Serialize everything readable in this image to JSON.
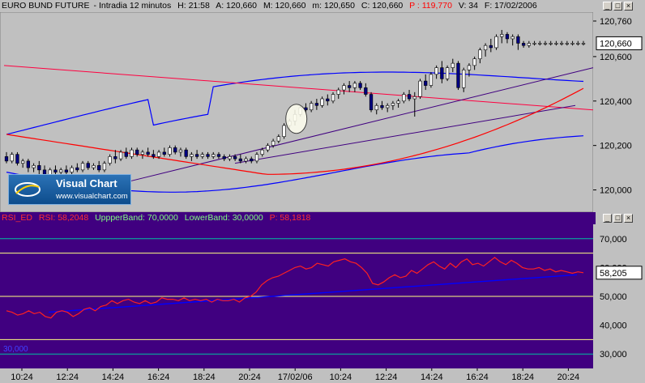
{
  "price_header": {
    "instrument": "EURO BUND FUTURE",
    "period": "Intradia 12 minutos",
    "hour": "H: 21:58",
    "open": "A: 120,660",
    "high": "M: 120,660",
    "low": "m: 120,650",
    "close": "C: 120,660",
    "change": "P : 119,770",
    "volume": "V: 34",
    "date": "F: 17/02/2006"
  },
  "rsi_header": {
    "name": "RSI_ED",
    "rsi": "RSI: 58,2048",
    "upper": "UppperBand: 70,0000",
    "lower": "LowerBand: 30,0000",
    "p": "P: 58,1818"
  },
  "logo": {
    "title": "Visual Chart",
    "url": "www.visualchart.com"
  },
  "colors": {
    "price_bg": "#c0c0c0",
    "rsi_bg": "#400080",
    "candle_up": "#ffffff",
    "candle_down": "#000080",
    "bollinger": "#0000ff",
    "moving_avg": "#ff0000",
    "trendline_dark": "#400080",
    "trendline_red": "#ff0040",
    "rsi_line": "#ff2020",
    "rsi_trend": "#0000ff",
    "band_line": "#ffff80",
    "level_line": "#00c0a0"
  },
  "chart_data": [
    {
      "type": "candlestick",
      "title": "EURO BUND FUTURE - Intradia 12 minutos",
      "ylim": [
        119.9,
        120.8
      ],
      "y_ticks": [
        "120,760",
        "120,600",
        "120,400",
        "120,200",
        "120,000"
      ],
      "last_price_label": "120,660",
      "x_ticks": [
        "10:24",
        "12:24",
        "14:24",
        "16:24",
        "18:24",
        "20:24",
        "17/02/06",
        "10:24",
        "12:24",
        "14:24",
        "16:24",
        "18:24",
        "20:24"
      ],
      "candles": [
        [
          120.15,
          120.17,
          120.12,
          120.13
        ],
        [
          120.13,
          120.17,
          120.12,
          120.16
        ],
        [
          120.16,
          120.17,
          120.11,
          120.12
        ],
        [
          120.12,
          120.14,
          120.1,
          120.13
        ],
        [
          120.13,
          120.14,
          120.08,
          120.1
        ],
        [
          120.1,
          120.12,
          120.08,
          120.11
        ],
        [
          120.11,
          120.13,
          120.07,
          120.09
        ],
        [
          120.09,
          120.11,
          120.06,
          120.07
        ],
        [
          120.07,
          120.1,
          120.06,
          120.09
        ],
        [
          120.09,
          120.11,
          120.07,
          120.08
        ],
        [
          120.08,
          120.1,
          120.07,
          120.09
        ],
        [
          120.09,
          120.11,
          120.07,
          120.08
        ],
        [
          120.08,
          120.11,
          120.07,
          120.1
        ],
        [
          120.1,
          120.12,
          120.08,
          120.09
        ],
        [
          120.09,
          120.13,
          120.08,
          120.12
        ],
        [
          120.12,
          120.13,
          120.09,
          120.1
        ],
        [
          120.1,
          120.12,
          120.09,
          120.11
        ],
        [
          120.11,
          120.13,
          120.08,
          120.09
        ],
        [
          120.09,
          120.13,
          120.08,
          120.12
        ],
        [
          120.12,
          120.16,
          120.11,
          120.15
        ],
        [
          120.15,
          120.18,
          120.12,
          120.14
        ],
        [
          120.14,
          120.18,
          120.13,
          120.17
        ],
        [
          120.17,
          120.19,
          120.14,
          120.15
        ],
        [
          120.15,
          120.19,
          120.14,
          120.18
        ],
        [
          120.18,
          120.19,
          120.15,
          120.16
        ],
        [
          120.16,
          120.18,
          120.14,
          120.17
        ],
        [
          120.17,
          120.19,
          120.15,
          120.16
        ],
        [
          120.16,
          120.18,
          120.14,
          120.15
        ],
        [
          120.15,
          120.18,
          120.14,
          120.17
        ],
        [
          120.17,
          120.19,
          120.15,
          120.16
        ],
        [
          120.16,
          120.2,
          120.15,
          120.19
        ],
        [
          120.19,
          120.2,
          120.16,
          120.17
        ],
        [
          120.17,
          120.19,
          120.15,
          120.18
        ],
        [
          120.18,
          120.19,
          120.14,
          120.15
        ],
        [
          120.15,
          120.17,
          120.13,
          120.16
        ],
        [
          120.16,
          120.18,
          120.14,
          120.15
        ],
        [
          120.15,
          120.17,
          120.14,
          120.16
        ],
        [
          120.16,
          120.17,
          120.14,
          120.15
        ],
        [
          120.15,
          120.17,
          120.14,
          120.16
        ],
        [
          120.16,
          120.17,
          120.14,
          120.15
        ],
        [
          120.15,
          120.16,
          120.13,
          120.14
        ],
        [
          120.14,
          120.16,
          120.13,
          120.15
        ],
        [
          120.15,
          120.16,
          120.13,
          120.14
        ],
        [
          120.14,
          120.16,
          120.12,
          120.13
        ],
        [
          120.13,
          120.15,
          120.12,
          120.14
        ],
        [
          120.14,
          120.15,
          120.12,
          120.13
        ],
        [
          120.13,
          120.17,
          120.12,
          120.16
        ],
        [
          120.16,
          120.19,
          120.15,
          120.18
        ],
        [
          120.18,
          120.21,
          120.17,
          120.2
        ],
        [
          120.2,
          120.23,
          120.19,
          120.22
        ],
        [
          120.22,
          120.25,
          120.21,
          120.24
        ],
        [
          120.24,
          120.3,
          120.23,
          120.29
        ],
        [
          120.29,
          120.32,
          120.27,
          120.31
        ],
        [
          120.31,
          120.36,
          120.29,
          120.34
        ],
        [
          120.34,
          120.38,
          120.33,
          120.37
        ],
        [
          120.37,
          120.39,
          120.34,
          120.36
        ],
        [
          120.36,
          120.4,
          120.35,
          120.39
        ],
        [
          120.39,
          120.41,
          120.36,
          120.38
        ],
        [
          120.38,
          120.42,
          120.37,
          120.41
        ],
        [
          120.41,
          120.43,
          120.38,
          120.4
        ],
        [
          120.4,
          120.44,
          120.39,
          120.43
        ],
        [
          120.43,
          120.46,
          120.41,
          120.45
        ],
        [
          120.45,
          120.48,
          120.43,
          120.47
        ],
        [
          120.47,
          120.49,
          120.44,
          120.46
        ],
        [
          120.46,
          120.49,
          120.44,
          120.48
        ],
        [
          120.48,
          120.49,
          120.45,
          120.46
        ],
        [
          120.46,
          120.48,
          120.42,
          120.43
        ],
        [
          120.43,
          120.44,
          120.35,
          120.36
        ],
        [
          120.36,
          120.39,
          120.34,
          120.38
        ],
        [
          120.38,
          120.4,
          120.36,
          120.37
        ],
        [
          120.37,
          120.39,
          120.35,
          120.38
        ],
        [
          120.38,
          120.4,
          120.36,
          120.39
        ],
        [
          120.39,
          120.41,
          120.37,
          120.4
        ],
        [
          120.4,
          120.44,
          120.39,
          120.43
        ],
        [
          120.43,
          120.45,
          120.4,
          120.41
        ],
        [
          120.41,
          120.44,
          120.33,
          120.42
        ],
        [
          120.42,
          120.5,
          120.41,
          120.49
        ],
        [
          120.49,
          120.52,
          120.45,
          120.47
        ],
        [
          120.47,
          120.53,
          120.46,
          120.52
        ],
        [
          120.52,
          120.56,
          120.5,
          120.55
        ],
        [
          120.55,
          120.58,
          120.48,
          120.5
        ],
        [
          120.5,
          120.56,
          120.49,
          120.55
        ],
        [
          120.55,
          120.59,
          120.53,
          120.57
        ],
        [
          120.57,
          120.58,
          120.45,
          120.46
        ],
        [
          120.46,
          120.55,
          120.44,
          120.54
        ],
        [
          120.54,
          120.57,
          120.51,
          120.56
        ],
        [
          120.56,
          120.6,
          120.54,
          120.59
        ],
        [
          120.59,
          120.64,
          120.57,
          120.63
        ],
        [
          120.63,
          120.66,
          120.6,
          120.65
        ],
        [
          120.65,
          120.68,
          120.62,
          120.64
        ],
        [
          120.64,
          120.7,
          120.63,
          120.69
        ],
        [
          120.69,
          120.72,
          120.66,
          120.7
        ],
        [
          120.7,
          120.71,
          120.66,
          120.68
        ],
        [
          120.68,
          120.7,
          120.65,
          120.69
        ],
        [
          120.69,
          120.7,
          120.63,
          120.66
        ],
        [
          120.66,
          120.67,
          120.64,
          120.65
        ],
        [
          120.65,
          120.67,
          120.64,
          120.66
        ],
        [
          120.66,
          120.67,
          120.65,
          120.66
        ],
        [
          120.66,
          120.67,
          120.65,
          120.66
        ],
        [
          120.66,
          120.67,
          120.65,
          120.66
        ],
        [
          120.66,
          120.67,
          120.65,
          120.66
        ],
        [
          120.66,
          120.67,
          120.65,
          120.66
        ],
        [
          120.66,
          120.67,
          120.65,
          120.66
        ],
        [
          120.66,
          120.67,
          120.65,
          120.66
        ],
        [
          120.66,
          120.67,
          120.65,
          120.66
        ],
        [
          120.66,
          120.67,
          120.65,
          120.66
        ],
        [
          120.66,
          120.67,
          120.65,
          120.66
        ]
      ]
    },
    {
      "type": "line",
      "title": "RSI_ED",
      "ylim": [
        25,
        75
      ],
      "y_ticks": [
        "70,000",
        "60,000",
        "50,000",
        "40,000",
        "30,000"
      ],
      "last_value_label": "58,205",
      "left_label": "30,000",
      "upper_band": 70,
      "lower_band": 30,
      "series": [
        {
          "name": "RSI",
          "values": [
            45.0,
            44.5,
            43.5,
            44.0,
            45.0,
            44.0,
            44.5,
            43.0,
            42.5,
            44.5,
            45.0,
            44.5,
            43.0,
            44.0,
            45.5,
            46.0,
            45.0,
            46.5,
            47.0,
            48.5,
            47.5,
            48.5,
            49.0,
            48.0,
            47.5,
            48.5,
            47.5,
            48.0,
            49.5,
            49.0,
            49.0,
            48.5,
            49.5,
            48.5,
            49.0,
            48.5,
            49.0,
            48.0,
            49.0,
            48.5,
            48.5,
            49.0,
            48.0,
            49.5,
            50.0,
            51.5,
            54.0,
            55.5,
            56.5,
            57.0,
            58.0,
            59.0,
            60.0,
            60.5,
            59.5,
            60.0,
            61.5,
            61.0,
            60.5,
            62.0,
            62.5,
            63.0,
            62.0,
            61.5,
            60.0,
            58.0,
            54.5,
            54.0,
            55.0,
            56.5,
            57.5,
            56.5,
            57.0,
            59.0,
            58.0,
            59.5,
            61.0,
            62.0,
            60.5,
            59.5,
            61.5,
            60.0,
            62.0,
            63.0,
            61.0,
            61.5,
            60.5,
            62.0,
            63.5,
            62.0,
            61.0,
            62.5,
            61.5,
            60.0,
            59.5,
            59.5,
            60.0,
            59.0,
            59.5,
            58.5,
            59.0,
            58.5,
            58.0,
            58.5,
            58.2
          ]
        }
      ],
      "x_ticks": [
        "10:24",
        "12:24",
        "14:24",
        "16:24",
        "18:24",
        "20:24",
        "17/02/06",
        "10:24",
        "12:24",
        "14:24",
        "16:24",
        "18:24",
        "20:24"
      ]
    }
  ]
}
